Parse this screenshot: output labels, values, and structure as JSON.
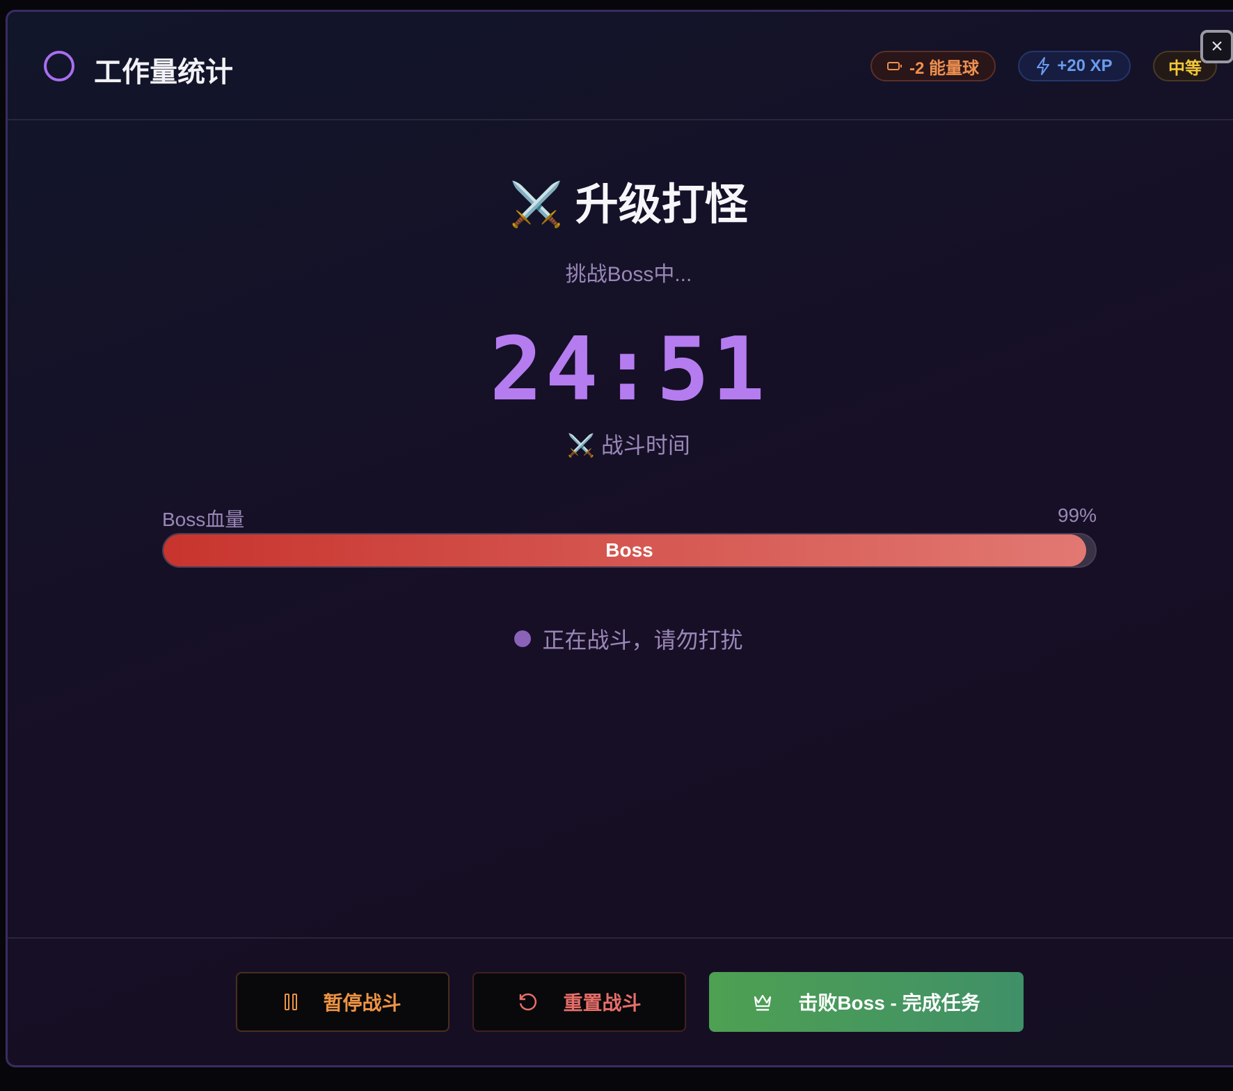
{
  "header": {
    "title": "工作量统计",
    "badges": {
      "energy": "-2 能量球",
      "xp": "+20 XP",
      "difficulty": "中等"
    },
    "close": "×"
  },
  "main": {
    "title_icon": "⚔️",
    "title": "升级打怪",
    "subtitle": "挑战Boss中...",
    "timer": "24:51",
    "timer_label": "⚔️ 战斗时间",
    "boss_hp": {
      "label": "Boss血量",
      "percent_text": "99%",
      "value": 0.99,
      "bar_label": "Boss"
    },
    "status": "正在战斗，请勿打扰"
  },
  "footer": {
    "pause": "暂停战斗",
    "reset": "重置战斗",
    "defeat": "击败Boss - 完成任务"
  },
  "colors": {
    "accent": "#b57cf0",
    "boss_bar": "#d9534f",
    "success": "#4ea052"
  }
}
